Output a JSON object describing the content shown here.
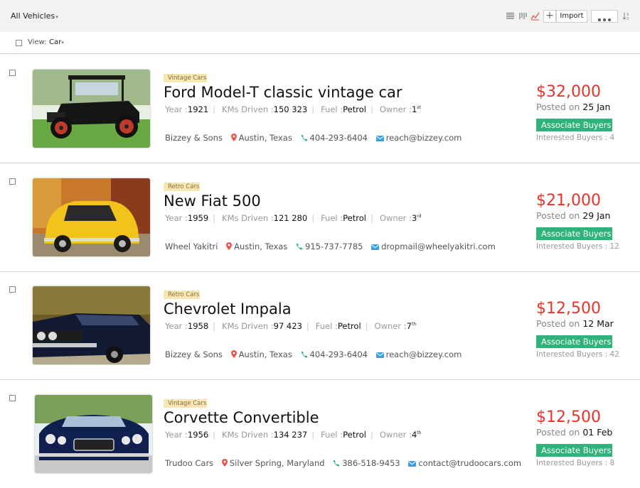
{
  "header": {
    "breadcrumb": "All Vehicles",
    "toolbar": {
      "icons": [
        "list-view-icon",
        "kanban-view-icon",
        "chart-view-icon",
        "plus-icon",
        "more-icon",
        "sort-icon"
      ],
      "add_label": "+",
      "import_label": "Import"
    },
    "view": {
      "label": "View:",
      "value": "Car"
    }
  },
  "listings": [
    {
      "category": "Vintage Cars",
      "title": "Ford Model-T classic vintage car",
      "year_label": "Year :",
      "year": "1921",
      "kms_label": "KMs Driven :",
      "kms": "150 323",
      "fuel_label": "Fuel :",
      "fuel": "Petrol",
      "owner_label": "Owner :",
      "owner": "1",
      "owner_suffix": "st",
      "dealer": "Bizzey & Sons",
      "location": "Austin, Texas",
      "phone": "404-293-6404",
      "email": "reach@bizzey.com",
      "price": "$32,000",
      "posted_label": "Posted on",
      "posted_date": "25 Jan",
      "action_label": "Associate Buyers",
      "interested": "Interested Buyers : 4",
      "image": "ford-model-t-photo"
    },
    {
      "category": "Retro Cars",
      "title": "New Fiat 500",
      "year_label": "Year :",
      "year": "1959",
      "kms_label": "KMs Driven :",
      "kms": "121 280",
      "fuel_label": "Fuel :",
      "fuel": "Petrol",
      "owner_label": "Owner :",
      "owner": "3",
      "owner_suffix": "rd",
      "dealer": "Wheel Yakitri",
      "location": "Austin, Texas",
      "phone": "915-737-7785",
      "email": "dropmail@wheelyakitri.com",
      "price": "$21,000",
      "posted_label": "Posted on",
      "posted_date": "29 Jan",
      "action_label": "Associate Buyers",
      "interested": "Interested Buyers : 12",
      "image": "fiat-500-photo"
    },
    {
      "category": "Retro Cars",
      "title": "Chevrolet Impala",
      "year_label": "Year :",
      "year": "1958",
      "kms_label": "KMs Driven :",
      "kms": "97 423",
      "fuel_label": "Fuel :",
      "fuel": "Petrol",
      "owner_label": "Owner :",
      "owner": "7",
      "owner_suffix": "th",
      "dealer": "Bizzey & Sons",
      "location": "Austin, Texas",
      "phone": "404-293-6404",
      "email": "reach@bizzey.com",
      "price": "$12,500",
      "posted_label": "Posted on",
      "posted_date": "12 Mar",
      "action_label": "Associate Buyers",
      "interested": "Interested Buyers : 42",
      "image": "chevrolet-impala-photo"
    },
    {
      "category": "Vintage Cars",
      "title": "Corvette Convertible",
      "year_label": "Year :",
      "year": "1956",
      "kms_label": "KMs Driven :",
      "kms": "134 237",
      "fuel_label": "Fuel :",
      "fuel": "Petrol",
      "owner_label": "Owner :",
      "owner": "4",
      "owner_suffix": "th",
      "dealer": "Trudoo Cars",
      "location": "Silver Spring, Maryland",
      "phone": "386-518-9453",
      "email": "contact@trudoocars.com",
      "price": "$12,500",
      "posted_label": "Posted on",
      "posted_date": "01 Feb",
      "action_label": "Associate Buyers",
      "interested": "Interested Buyers : 8",
      "image": "corvette-convertible-photo"
    }
  ],
  "colors": {
    "price": "#e8332b",
    "action": "#2fb37a",
    "tag_bg": "#f7e7b3",
    "location_icon": "#e8534b",
    "phone_icon": "#2fb37a",
    "email_icon": "#3aa0e0"
  }
}
